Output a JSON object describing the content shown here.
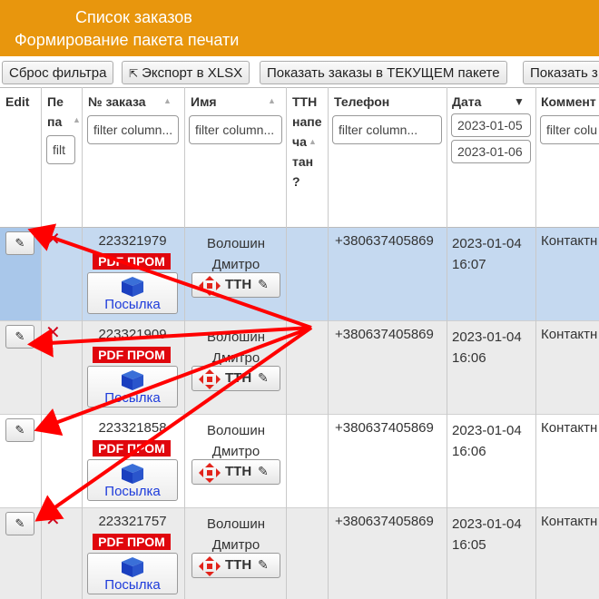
{
  "header": {
    "title": "Список заказов",
    "subtitle": "Формирование пакета печати"
  },
  "toolbar": {
    "reset_filter": "Сброс фильтра",
    "export_xlsx": "Экспорт в XLSX",
    "show_current": "Показать заказы в ТЕКУЩЕМ пакете",
    "show_other": "Показать з"
  },
  "columns": {
    "edit": "Edit",
    "printed_lines": [
      "Пе",
      "па"
    ],
    "order_no": "№ заказа",
    "name": "Имя",
    "ttn_lines": [
      "ТТН",
      "напе",
      "ча",
      "тан",
      "?"
    ],
    "phone": "Телефон",
    "date": "Дата",
    "comment": "Коммент"
  },
  "filters": {
    "printed": "filt",
    "order_no": "filter column...",
    "name": "filter column...",
    "phone": "filter column...",
    "date_from": "2023-01-05",
    "date_to": "2023-01-06",
    "comment": "filter colu"
  },
  "labels": {
    "pdf_badge": "PDF ПРОМ",
    "parcel": "Посылка",
    "ttn": "ТТН"
  },
  "rows": [
    {
      "order": "223321979",
      "name1": "Волошин",
      "name2": "Дмитро",
      "phone": "+380637405869",
      "date": "2023-01-04",
      "time": "16:07",
      "comment": "Контактн"
    },
    {
      "order": "223321909",
      "name1": "Волошин",
      "name2": "Дмитро",
      "phone": "+380637405869",
      "date": "2023-01-04",
      "time": "16:06",
      "comment": "Контактн"
    },
    {
      "order": "223321858",
      "name1": "Волошин",
      "name2": "Дмитро",
      "phone": "+380637405869",
      "date": "2023-01-04",
      "time": "16:06",
      "comment": "Контактн"
    },
    {
      "order": "223321757",
      "name1": "Волошин",
      "name2": "Дмитро",
      "phone": "+380637405869",
      "date": "2023-01-04",
      "time": "16:05",
      "comment": "Контактн"
    }
  ],
  "colors": {
    "header_bg": "#e8960d",
    "selected_row": "#c5d9f0",
    "pdf_red": "#e0060d",
    "arrow_red": "#ff0000",
    "parcel_blue": "#1d3bdb"
  }
}
